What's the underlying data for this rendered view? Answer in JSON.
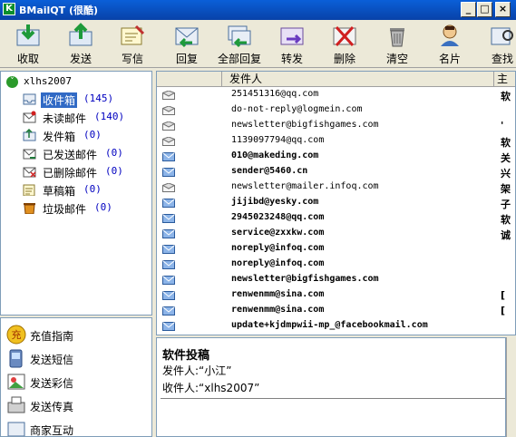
{
  "window": {
    "title": "BMailQT (很酷)"
  },
  "toolbar": {
    "items": [
      {
        "label": "收取"
      },
      {
        "label": "发送"
      },
      {
        "label": "写信"
      },
      {
        "label": "回复"
      },
      {
        "label": "全部回复"
      },
      {
        "label": "转发"
      },
      {
        "label": "删除"
      },
      {
        "label": "清空"
      },
      {
        "label": "名片"
      },
      {
        "label": "查找"
      }
    ]
  },
  "account": {
    "name": "xlhs2007"
  },
  "folders": [
    {
      "name": "收件箱",
      "count": "(145)",
      "selected": true
    },
    {
      "name": "未读邮件",
      "count": "(140)"
    },
    {
      "name": "发件箱",
      "count": "(0)"
    },
    {
      "name": "已发送邮件",
      "count": "(0)"
    },
    {
      "name": "已删除邮件",
      "count": "(0)"
    },
    {
      "name": "草稿箱",
      "count": "(0)"
    },
    {
      "name": "垃圾邮件",
      "count": "(0)"
    }
  ],
  "shortcuts": [
    {
      "label": "充值指南"
    },
    {
      "label": "发送短信"
    },
    {
      "label": "发送彩信"
    },
    {
      "label": "发送传真"
    },
    {
      "label": "商家互动"
    }
  ],
  "list": {
    "columns": {
      "sender": "发件人",
      "subject": "主"
    },
    "rows": [
      {
        "sender": "251451316@qq.com",
        "subject": "软",
        "unread": false
      },
      {
        "sender": "do-not-reply@logmein.com",
        "subject": "",
        "unread": false
      },
      {
        "sender": "newsletter@bigfishgames.com",
        "subject": "'",
        "unread": false
      },
      {
        "sender": "1139097794@qq.com",
        "subject": "软",
        "unread": false
      },
      {
        "sender": "010@makeding.com",
        "subject": "关",
        "unread": true
      },
      {
        "sender": "sender@5460.cn",
        "subject": "兴",
        "unread": true
      },
      {
        "sender": "newsletter@mailer.infoq.com",
        "subject": "架",
        "unread": false
      },
      {
        "sender": "jijibd@yesky.com",
        "subject": "子",
        "unread": true
      },
      {
        "sender": "2945023248@qq.com",
        "subject": "软",
        "unread": true
      },
      {
        "sender": "service@zxxkw.com",
        "subject": "诚",
        "unread": true
      },
      {
        "sender": " noreply@infoq.com",
        "subject": "",
        "unread": true
      },
      {
        "sender": " noreply@infoq.com",
        "subject": "",
        "unread": true
      },
      {
        "sender": "newsletter@bigfishgames.com",
        "subject": "",
        "unread": true
      },
      {
        "sender": "renwenmm@sina.com",
        "subject": "[",
        "unread": true
      },
      {
        "sender": "renwenmm@sina.com",
        "subject": "[",
        "unread": true
      },
      {
        "sender": "update+kjdmpwii-mp_@facebookmail.com",
        "subject": "",
        "unread": true
      }
    ]
  },
  "preview": {
    "title": "软件投稿",
    "from": "发件人:“小江”",
    "to": "收件人:“xlhs2007”"
  },
  "colors": {
    "titlebar": "#0a5fd8",
    "selection": "#316ac5",
    "count": "#0000c0"
  }
}
